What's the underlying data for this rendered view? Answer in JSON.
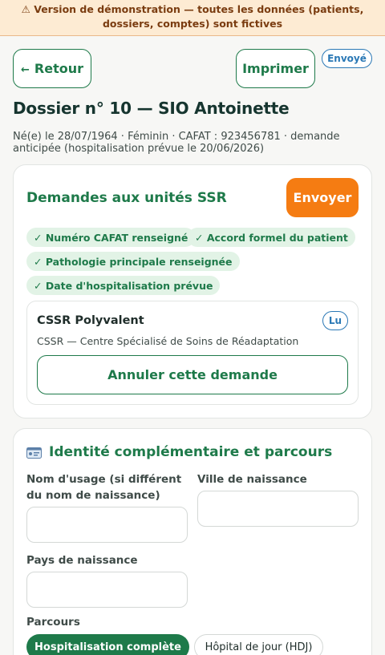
{
  "banner": {
    "text": "⚠ Version de démonstration — toutes les données (patients, dossiers, comptes) sont fictives"
  },
  "toolbar": {
    "back_arrow": "←",
    "back_label": "Retour",
    "print_label": "Imprimer",
    "status_badge": "Envoyé"
  },
  "dossier": {
    "title": "Dossier n° 10 — SIO Antoinette",
    "meta": "Né(e) le 28/07/1964 · Féminin · CAFAT : 923456781 · demande anticipée (hospitalisation prévue le 20/06/2026)"
  },
  "requests": {
    "title": "Demandes aux unités SSR",
    "send_label": "Envoyer",
    "checks": [
      "✓ Numéro CAFAT renseigné",
      "✓ Accord formel du patient",
      "✓ Pathologie principale renseignée",
      "✓ Date d'hospitalisation prévue"
    ],
    "unit": {
      "name": "CSSR Polyvalent",
      "status": "Lu",
      "description": "CSSR — Centre Spécialisé de Soins de Réadaptation",
      "cancel_label": "Annuler cette demande"
    }
  },
  "identity": {
    "title": "Identité complémentaire et parcours",
    "usage_name_label": "Nom d'usage (si différent du nom de naissance)",
    "usage_name_value": "",
    "birth_city_label": "Ville de naissance",
    "birth_city_value": "",
    "birth_country_label": "Pays de naissance",
    "birth_country_value": "",
    "pathway_label": "Parcours",
    "pathway_options": [
      "Hospitalisation complète",
      "Hôpital de jour (HDJ)"
    ],
    "pathway_selected": "Hospitalisation complète"
  },
  "colors": {
    "primary_green": "#1e7a4a",
    "accent_orange": "#f57c12",
    "info_blue": "#2a78b5",
    "banner_bg": "#fdebd3"
  },
  "icons": {
    "back": "arrow-left-icon",
    "identity": "id-card-icon"
  }
}
